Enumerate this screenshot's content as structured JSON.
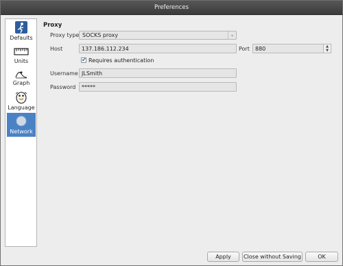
{
  "window": {
    "title": "Preferences"
  },
  "sidebar": {
    "items": [
      {
        "label": "Defaults",
        "icon": "defaults-icon",
        "active": false
      },
      {
        "label": "Units",
        "icon": "ruler-icon",
        "active": false
      },
      {
        "label": "Graph",
        "icon": "graph-icon",
        "active": false
      },
      {
        "label": "Language",
        "icon": "language-icon",
        "active": false
      },
      {
        "label": "Network",
        "icon": "network-icon",
        "active": true
      }
    ]
  },
  "proxy": {
    "section_title": "Proxy",
    "type_label": "Proxy type",
    "type_value": "SOCKS proxy",
    "host_label": "Host",
    "host_value": "137.186.112.234",
    "port_label": "Port",
    "port_value": "880",
    "auth_label": "Requires authentication",
    "auth_checked": true,
    "username_label": "Username",
    "username_value": "JLSmith",
    "password_label": "Password",
    "password_value": "*****"
  },
  "buttons": {
    "apply": "Apply",
    "close_without_saving": "Close without Saving",
    "ok": "OK"
  },
  "colors": {
    "accent": "#4a82c6",
    "titlebar": "#474747"
  }
}
